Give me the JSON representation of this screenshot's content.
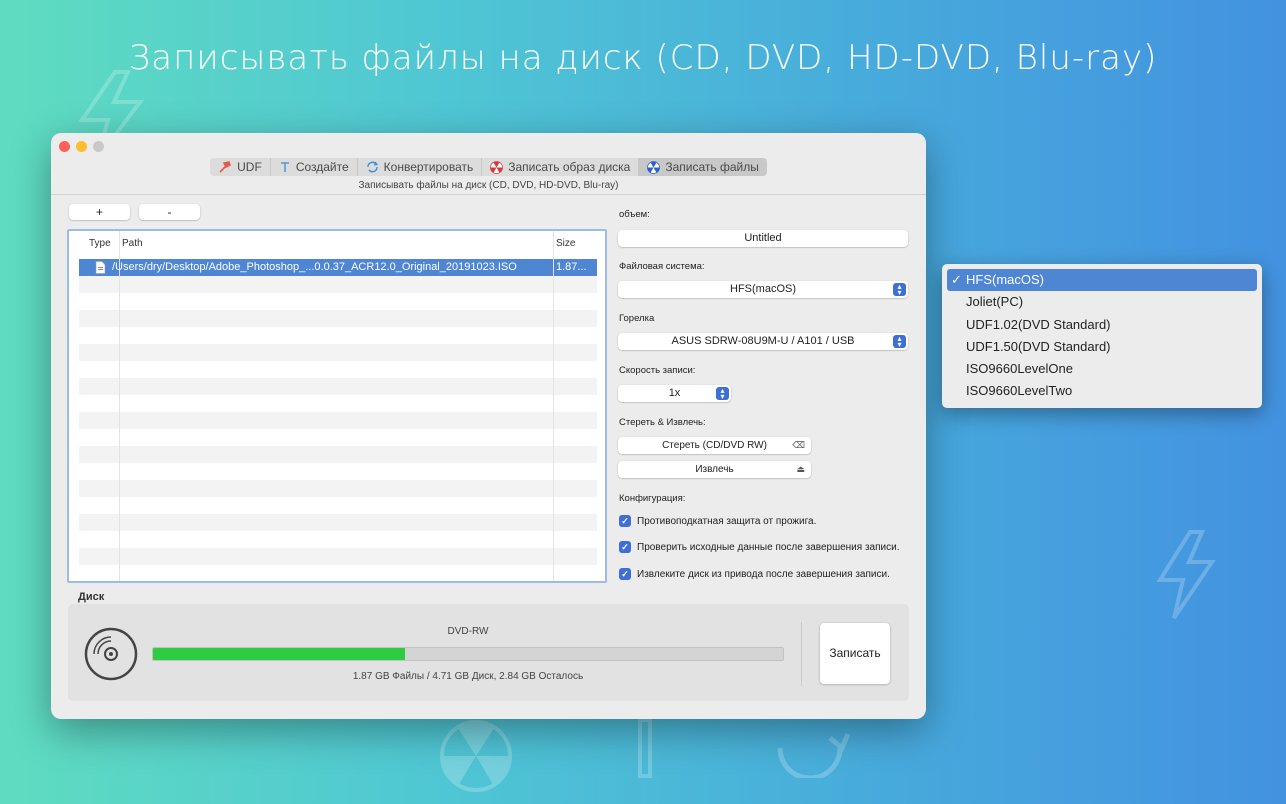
{
  "hero_title": "Записывать файлы на диск (CD, DVD, HD-DVD, Blu-ray)",
  "toolbar": {
    "tabs": [
      "UDF",
      "Создайте",
      "Конвертировать",
      "Записать образ диска",
      "Записать файлы"
    ],
    "subtitle": "Записывать файлы на диск (CD, DVD, HD-DVD, Blu-ray)"
  },
  "file_list": {
    "add_label": "+",
    "remove_label": "-",
    "columns": [
      "Type",
      "Path",
      "Size"
    ],
    "rows": [
      {
        "path": "/Users/dry/Desktop/Adobe_Photoshop_...0.0.37_ACR12.0_Original_20191023.ISO",
        "size": "1.87..."
      }
    ]
  },
  "settings": {
    "volume_label": "объем:",
    "volume_value": "Untitled",
    "fs_label": "Файловая система:",
    "fs_value": "HFS(macOS)",
    "burner_label": "Горелка",
    "burner_value": "ASUS SDRW-08U9M-U / A101 / USB",
    "speed_label": "Скорость записи:",
    "speed_value": "1x",
    "erase_section_label": "Стереть & Извлечь:",
    "erase_button": "Стереть (CD/DVD RW)",
    "eject_button": "Извлечь",
    "config_label": "Конфигурация:",
    "options": [
      "Противоподкатная защита от прожига.",
      "Проверить исходные данные после завершения записи.",
      "Извлеките диск из привода после завершения записи."
    ]
  },
  "disk": {
    "section_label": "Диск",
    "media_type": "DVD-RW",
    "progress_fraction": 0.4,
    "summary": "1.87 GB Файлы / 4.71 GB Диск, 2.84 GB Осталось",
    "burn_button": "Записать"
  },
  "fs_popup": {
    "options": [
      "HFS(macOS)",
      "Joliet(PC)",
      "UDF1.02(DVD Standard)",
      "UDF1.50(DVD Standard)",
      "ISO9660LevelOne",
      "ISO9660LevelTwo"
    ],
    "selected_index": 0,
    "check": "✓"
  },
  "colors": {
    "accent": "#4f86d4",
    "progress": "#2ecc40"
  }
}
